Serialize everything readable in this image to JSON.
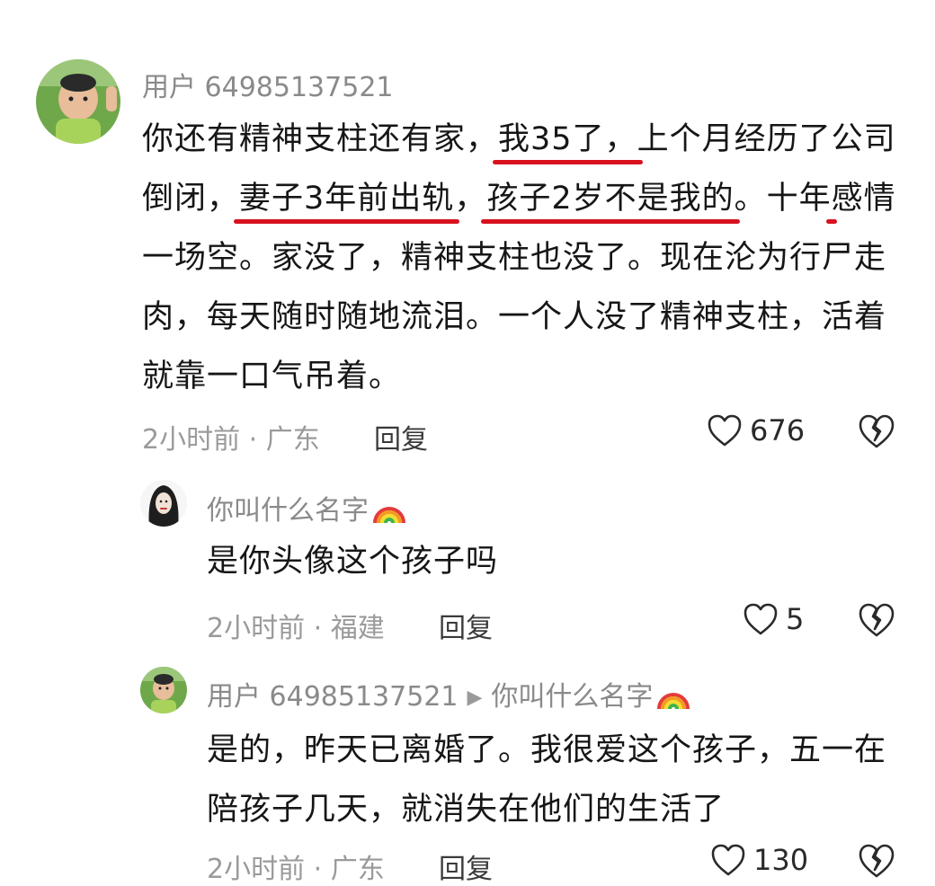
{
  "comments": [
    {
      "username": "用户 64985137521",
      "content_parts": [
        "你还有精神支柱还有家，",
        "我35了，",
        "上个月经历了",
        "公司倒闭",
        "，",
        "妻子3年前出轨",
        "，",
        "孩子2岁不是我的",
        "。十年感情一场空。家没了，精神支柱也没了。现在沦为行尸走肉，每天随时随地流泪。一个人没了精神支柱，活着就靠一口气吊着。"
      ],
      "time_location": "2小时前 · 广东",
      "reply_label": "回复",
      "likes": "676"
    },
    {
      "username": "你叫什么名字",
      "content": "是你头像这个孩子吗",
      "time_location": "2小时前 · 福建",
      "reply_label": "回复",
      "likes": "5"
    },
    {
      "username": "用户 64985137521",
      "reply_to": "你叫什么名字",
      "content": "是的，昨天已离婚了。我很爱这个孩子，五一在陪孩子几天，就消失在他们的生活了",
      "time_location": "2小时前 · 广东",
      "reply_label": "回复",
      "likes": "130"
    }
  ],
  "colors": {
    "highlight_underline": "#d8121e",
    "meta_text": "#9a9a9a",
    "username_text": "#8a8a8a"
  },
  "icons": [
    "heart-outline-icon",
    "broken-heart-icon",
    "rainbow-emoji",
    "reply-arrow-icon"
  ]
}
